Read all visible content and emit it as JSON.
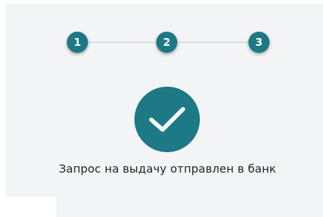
{
  "stepper": {
    "steps": [
      {
        "label": "1"
      },
      {
        "label": "2"
      },
      {
        "label": "3"
      }
    ],
    "current_step": 3,
    "accent_color": "#1d7984"
  },
  "result": {
    "icon": "checkmark-icon",
    "message": "Запрос на выдачу отправлен в банк"
  }
}
